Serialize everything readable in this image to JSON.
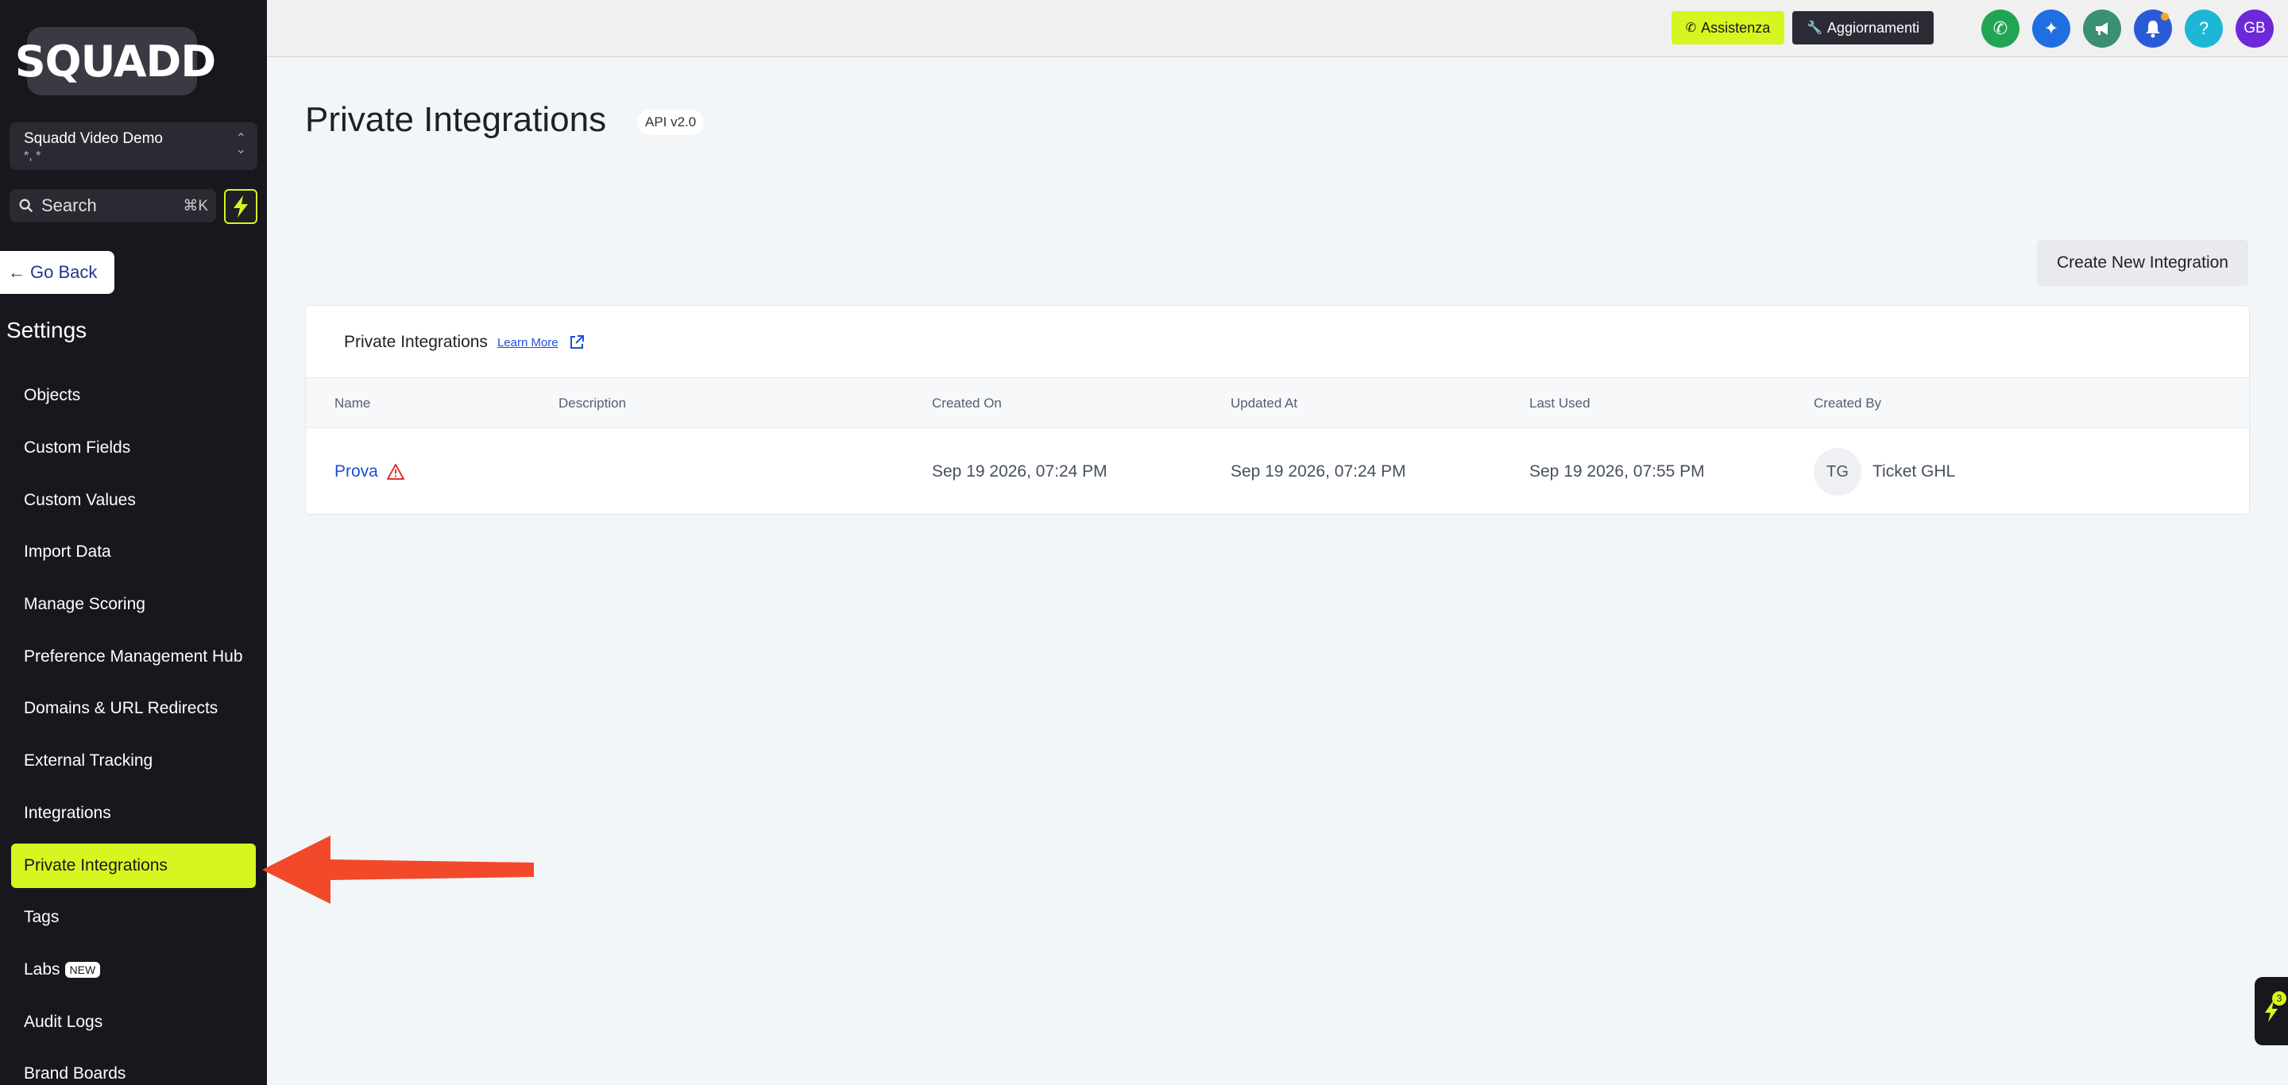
{
  "brand": {
    "logo_text": "SQUADD",
    "accent": "#d7f520"
  },
  "account": {
    "name": "Squadd Video Demo",
    "subtitle": "*, *"
  },
  "search": {
    "placeholder": "Search",
    "shortcut": "⌘K"
  },
  "sidebar": {
    "go_back": "Go Back",
    "section_title": "Settings",
    "items": [
      {
        "label": "Objects"
      },
      {
        "label": "Custom Fields"
      },
      {
        "label": "Custom Values"
      },
      {
        "label": "Import Data"
      },
      {
        "label": "Manage Scoring"
      },
      {
        "label": "Preference Management Hub"
      },
      {
        "label": "Domains & URL Redirects"
      },
      {
        "label": "External Tracking"
      },
      {
        "label": "Integrations"
      },
      {
        "label": "Private Integrations",
        "active": true
      },
      {
        "label": "Tags"
      },
      {
        "label": "Labs",
        "badge": "NEW"
      },
      {
        "label": "Audit Logs"
      },
      {
        "label": "Brand Boards"
      }
    ]
  },
  "topbar": {
    "assist_label": "Assistenza",
    "updates_label": "Aggiornamenti",
    "avatar_initials": "GB",
    "help_glyph": "?"
  },
  "page": {
    "title": "Private Integrations",
    "api_badge": "API v2.0",
    "create_button": "Create New Integration"
  },
  "card": {
    "title": "Private Integrations",
    "learn_more": "Learn More",
    "columns": [
      "Name",
      "Description",
      "Created On",
      "Updated At",
      "Last Used",
      "Created By"
    ],
    "rows": [
      {
        "name": "Prova",
        "description": "",
        "created_on": "Sep 19 2026, 07:24 PM",
        "updated_at": "Sep 19 2026, 07:24 PM",
        "last_used": "Sep 19 2026, 07:55 PM",
        "created_by_initials": "TG",
        "created_by": "Ticket GHL"
      }
    ]
  },
  "widget": {
    "count": "3"
  }
}
